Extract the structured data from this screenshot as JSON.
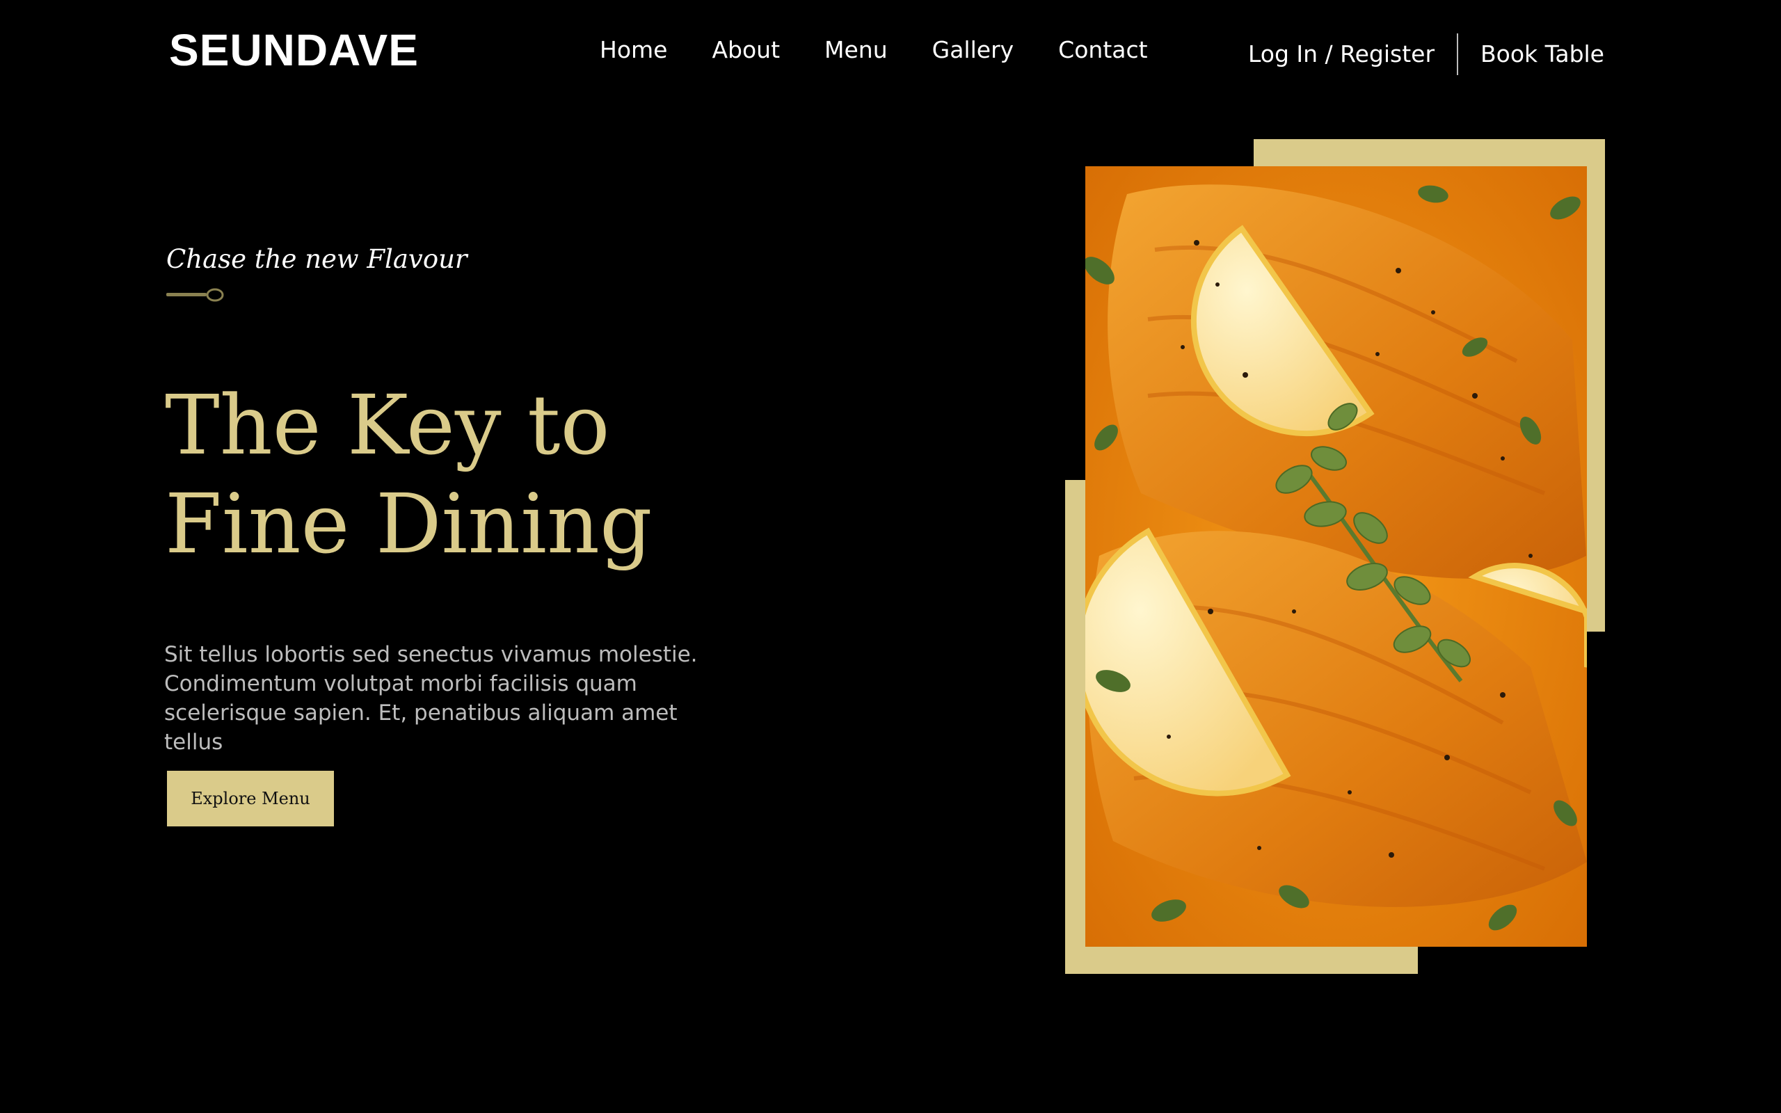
{
  "brand": {
    "logo_text": "SEUNDAVE",
    "accent_color": "#dacb8a",
    "background_color": "#000000"
  },
  "nav": {
    "items": [
      {
        "label": "Home"
      },
      {
        "label": "About"
      },
      {
        "label": "Menu"
      },
      {
        "label": "Gallery"
      },
      {
        "label": "Contact"
      }
    ]
  },
  "auth": {
    "login_label": "Log In / Register",
    "book_label": "Book Table"
  },
  "hero": {
    "tagline": "Chase the new Flavour",
    "tagline_icon": "spoon-icon",
    "headline": "The Key to Fine Dining",
    "description": "Sit tellus lobortis sed senectus vivamus molestie. Condimentum volutpat morbi facilisis quam scelerisque sapien. Et, penatibus aliquam amet tellus",
    "cta_label": "Explore Menu",
    "image_subject": "salmon-dish-icon"
  }
}
